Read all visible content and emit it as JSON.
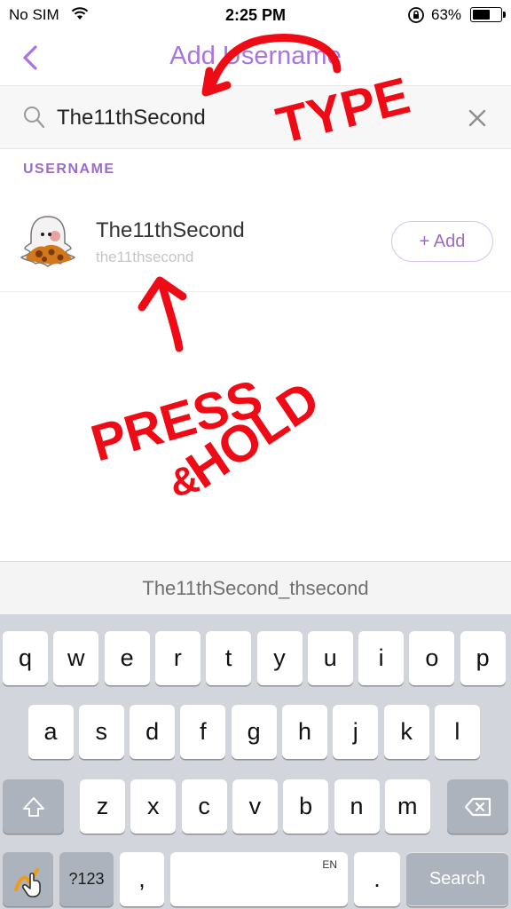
{
  "status_bar": {
    "carrier": "No SIM",
    "time": "2:25 PM",
    "battery": "63%",
    "battery_level": 0.63
  },
  "nav": {
    "title": "Add Username",
    "back_icon": "chevron-left-icon"
  },
  "search": {
    "value": "The11thSecond",
    "icon": "magnifier-icon",
    "clear_icon": "close-icon"
  },
  "section": {
    "label": "USERNAME"
  },
  "result": {
    "display_name": "The11thSecond",
    "username": "the11thsecond",
    "add_label": "+ Add"
  },
  "annotations": {
    "type": "TYPE",
    "press": "PRESS",
    "amp": "&",
    "hold": "HOLD",
    "color": "#ef0b16"
  },
  "suggestion": {
    "text": "The11thSecond_thsecond"
  },
  "keyboard": {
    "row1": [
      "q",
      "w",
      "e",
      "r",
      "t",
      "y",
      "u",
      "i",
      "o",
      "p"
    ],
    "row2": [
      "a",
      "s",
      "d",
      "f",
      "g",
      "h",
      "j",
      "k",
      "l"
    ],
    "row3": [
      "z",
      "x",
      "c",
      "v",
      "b",
      "n",
      "m"
    ],
    "numbers": "?123",
    "comma": ",",
    "space_lang": "EN",
    "period": ".",
    "search": "Search"
  },
  "colors": {
    "accent": "#a874e0",
    "keyboard_bg": "#d2d5db"
  }
}
